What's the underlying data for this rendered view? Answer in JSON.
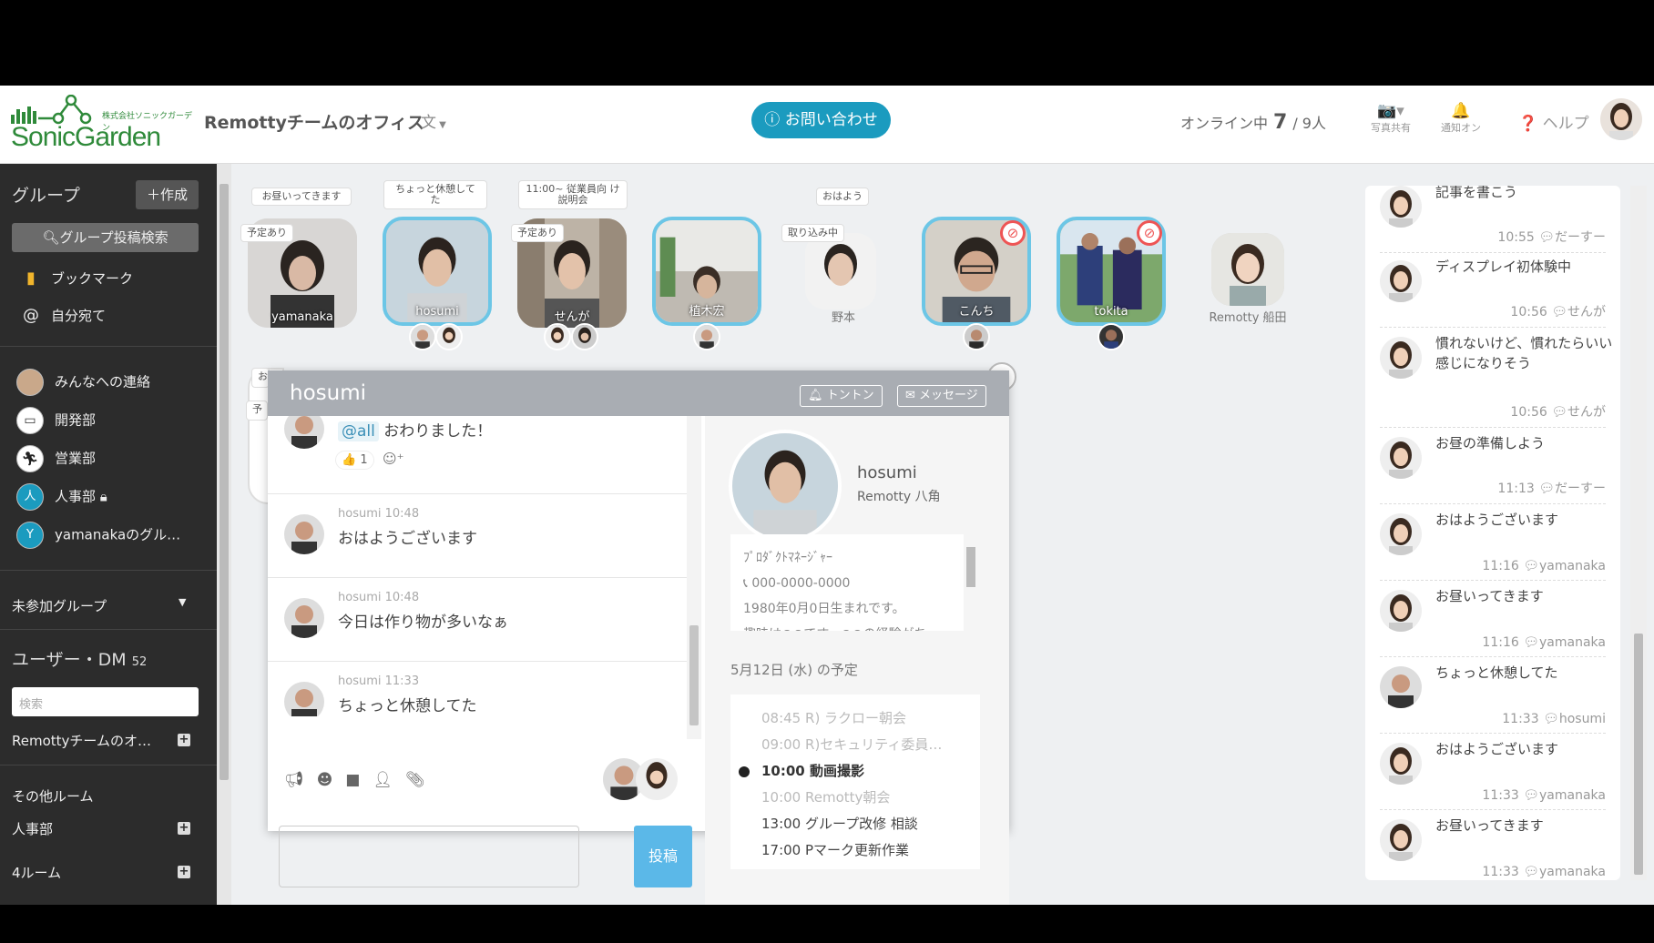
{
  "header": {
    "logo_text": "SonicGarden",
    "logo_sub": "株式会社ソニックガーデン",
    "office_title": "Remottyチームのオフィス",
    "contact_label": "お問い合わせ",
    "online_label": "オンライン中",
    "online_count": "7",
    "online_total": "/ 9人",
    "photo_label": "写真共有",
    "notify_label": "通知オン",
    "help_label": "ヘルプ"
  },
  "sidebar": {
    "group_heading": "グループ",
    "create_label": "作成",
    "search_label": "グループ投稿検索",
    "bookmark_label": "ブックマーク",
    "mentions_label": "自分宛て",
    "groups": [
      {
        "label": "みんなへの連絡",
        "color": "#c9a88a"
      },
      {
        "label": "開発部",
        "color": "#ffffff"
      },
      {
        "label": "営業部",
        "color": "#ffffff"
      },
      {
        "label": "人事部",
        "color": "#1b9bbf",
        "letter": "人"
      },
      {
        "label": "yamanakaのグル…",
        "color": "#1b9bbf",
        "letter": "Y"
      }
    ],
    "unjoined_label": "未参加グループ",
    "users_dm_label": "ユーザー・DM",
    "users_dm_count": "52",
    "search_placeholder": "検索",
    "office_room": "Remottyチームのオ…",
    "other_rooms_label": "その他ルーム",
    "room_1": "人事部",
    "room_2": "4ルーム"
  },
  "members": [
    {
      "name": "yamanaka",
      "bubble": "お昼いってきます",
      "tag": "予定あり"
    },
    {
      "name": "hosumi",
      "bubble": "ちょっと休憩して た"
    },
    {
      "name": "せんが",
      "bubble": "11:00~ 従業員向 け説明会",
      "tag": "予定あり"
    },
    {
      "name": "植木宏"
    },
    {
      "name": "野本",
      "bubble": "おはよう",
      "tag": "取り込み中"
    },
    {
      "name": "こんち"
    },
    {
      "name": "tokita"
    },
    {
      "name": "Remotty 船田"
    }
  ],
  "panel": {
    "title": "hosumi",
    "tonton_label": "トントン",
    "message_label": "メッセージ",
    "messages": [
      {
        "mention": "@all",
        "text": "おわりました！",
        "likes": "1"
      },
      {
        "author": "hosumi",
        "time": "10:48",
        "text": "おはようございます"
      },
      {
        "author": "hosumi",
        "time": "10:48",
        "text": "今日は作り物が多いなぁ"
      },
      {
        "author": "hosumi",
        "time": "11:33",
        "text": "ちょっと休憩してた"
      }
    ],
    "post_label": "投稿",
    "profile": {
      "name": "hosumi",
      "company": "Remotty 八角",
      "role": "ﾌﾟﾛﾀﾞｸﾄﾏﾈｰｼﾞｬｰ",
      "phone": "000-0000-0000",
      "birth": "1980年0月0日生まれです。",
      "hobby": "趣味は●●です。●●の経験がち"
    },
    "schedule_heading": "5月12日 (水) の予定",
    "schedule": [
      {
        "time": "08:45",
        "text": "R) ラクロー朝会",
        "state": "past"
      },
      {
        "time": "09:00",
        "text": "R)セキュリティ委員…",
        "state": "past"
      },
      {
        "time": "10:00",
        "text": "動画撮影",
        "state": "now"
      },
      {
        "time": "10:00",
        "text": "Remotty朝会",
        "state": "past"
      },
      {
        "time": "13:00",
        "text": "グループ改修 相談",
        "state": "fut"
      },
      {
        "time": "17:00",
        "text": "Pマーク更新作業",
        "state": "fut"
      }
    ]
  },
  "feed": [
    {
      "text": "記事を書こう",
      "time": "10:55",
      "user": "だーすー"
    },
    {
      "text": "ディスプレイ初体験中",
      "time": "10:56",
      "user": "せんが"
    },
    {
      "text": "慣れないけど、慣れたらいい感じになりそう",
      "time": "10:56",
      "user": "せんが"
    },
    {
      "text": "お昼の準備しよう",
      "time": "11:13",
      "user": "だーすー"
    },
    {
      "text": "おはようございます",
      "time": "11:16",
      "user": "yamanaka"
    },
    {
      "text": "お昼いってきます",
      "time": "11:16",
      "user": "yamanaka"
    },
    {
      "text": "ちょっと休憩してた",
      "time": "11:33",
      "user": "hosumi"
    },
    {
      "text": "おはようございます",
      "time": "11:33",
      "user": "yamanaka"
    },
    {
      "text": "お昼いってきます",
      "time": "11:33",
      "user": "yamanaka"
    }
  ],
  "colors": {
    "accent": "#1b9bbf",
    "active_ring": "#6cc6e6",
    "sidebar": "#2c2c2c"
  }
}
